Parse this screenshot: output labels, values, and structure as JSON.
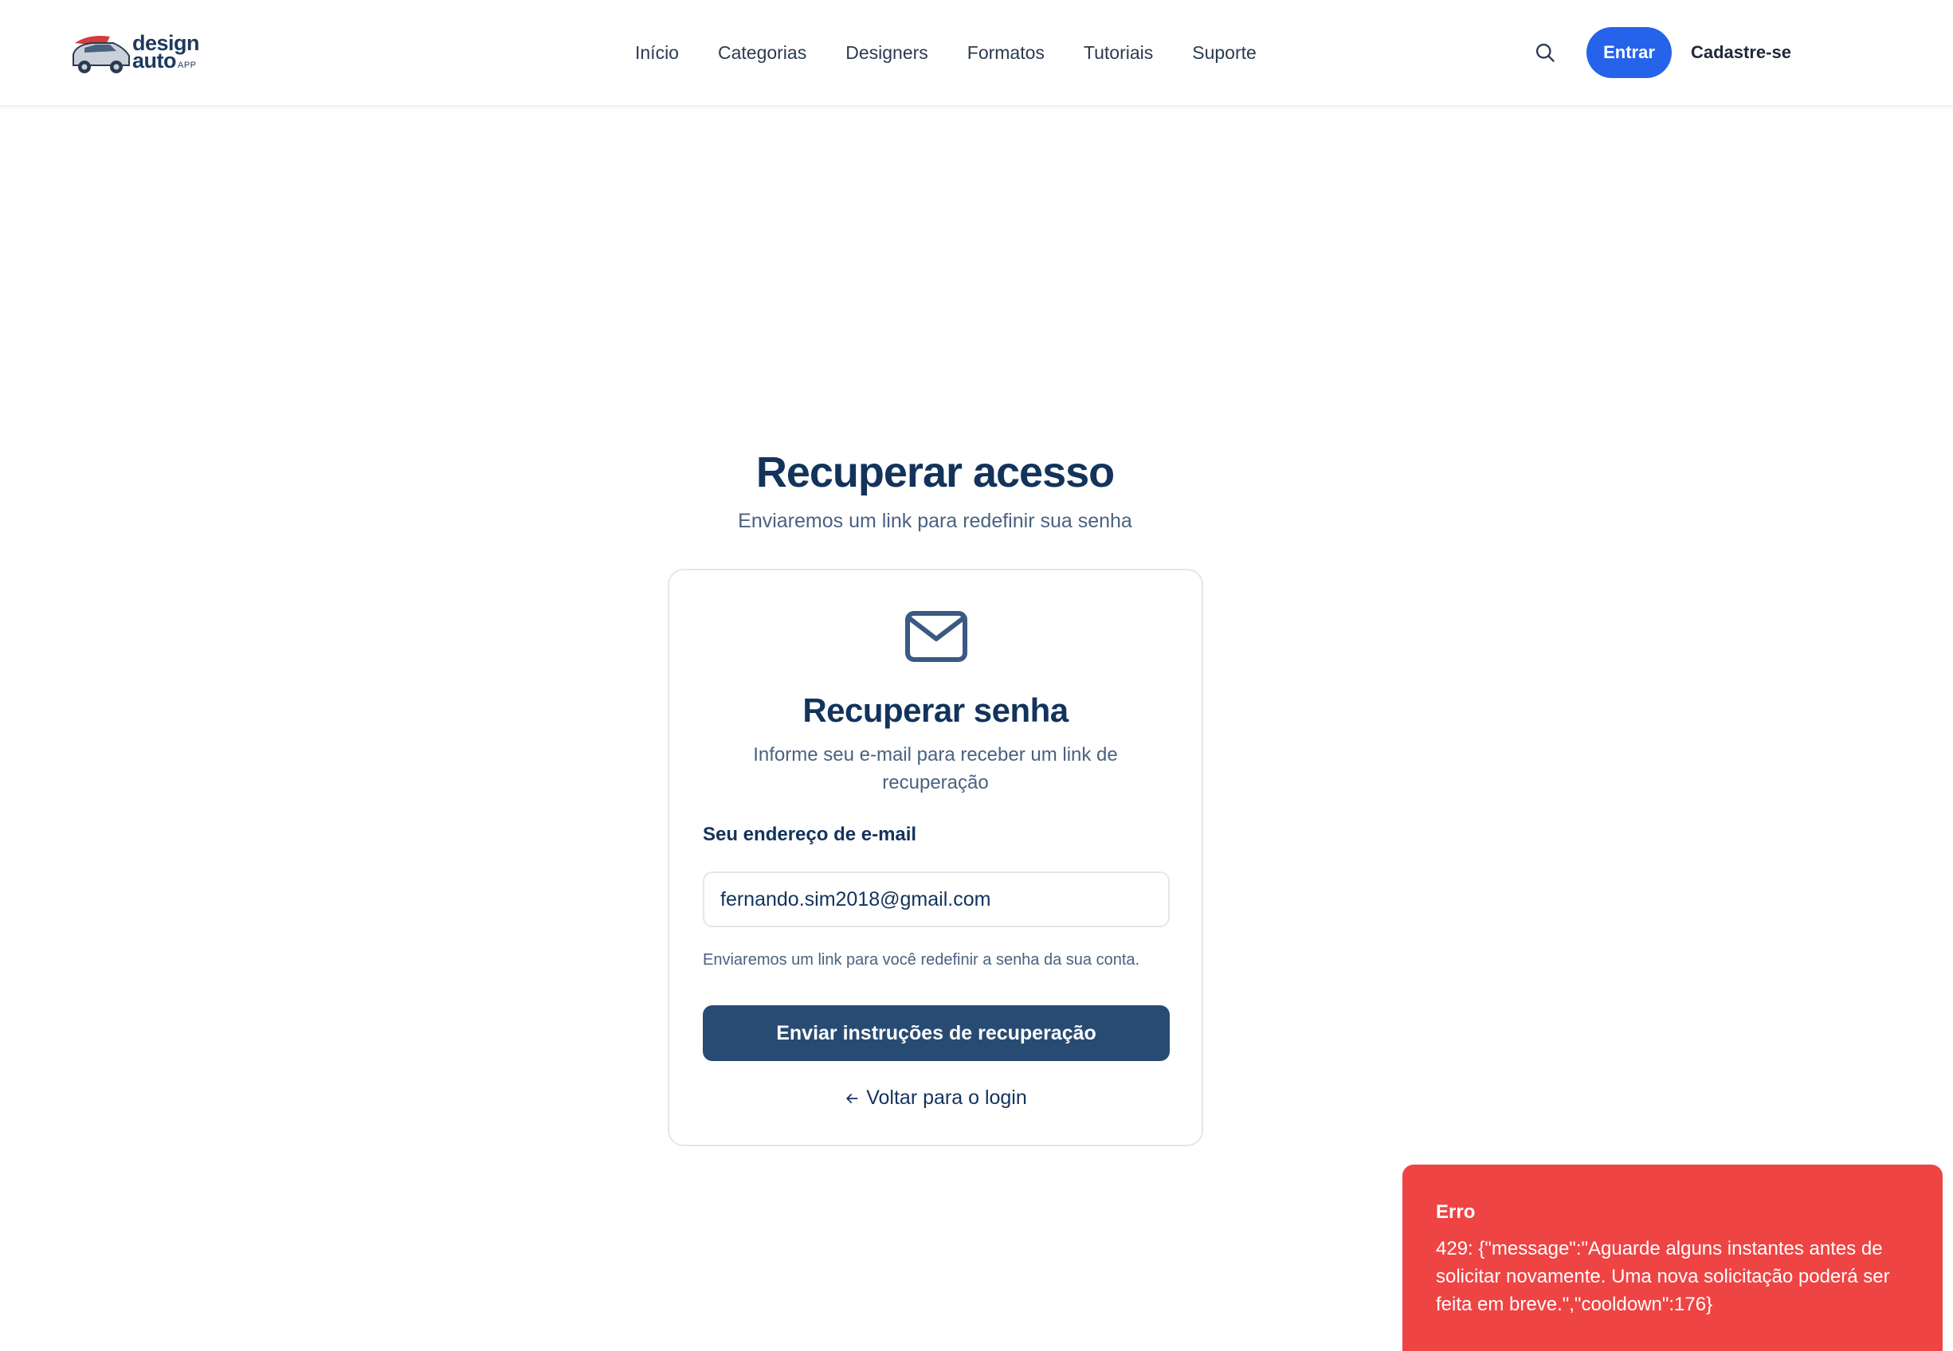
{
  "header": {
    "logo": {
      "line1": "design",
      "line2": "auto",
      "suffix": "APP"
    },
    "nav": [
      {
        "label": "Início"
      },
      {
        "label": "Categorias"
      },
      {
        "label": "Designers"
      },
      {
        "label": "Formatos"
      },
      {
        "label": "Tutoriais"
      },
      {
        "label": "Suporte"
      }
    ],
    "search_icon": "search-icon",
    "login_label": "Entrar",
    "signup_label": "Cadastre-se"
  },
  "main": {
    "title": "Recuperar acesso",
    "subtitle": "Enviaremos um link para redefinir sua senha"
  },
  "card": {
    "icon": "mail-icon",
    "title": "Recuperar senha",
    "description": "Informe seu e-mail para receber um link de recuperação",
    "email_label": "Seu endereço de e-mail",
    "email_value": "fernando.sim2018@gmail.com",
    "helper": "Enviaremos um link para você redefinir a senha da sua conta.",
    "submit_label": "Enviar instruções de recuperação",
    "back_label": "Voltar para o login"
  },
  "toast": {
    "title": "Erro",
    "message": "429: {\"message\":\"Aguarde alguns instantes antes de solicitar novamente. Uma nova solicitação poderá ser feita em breve.\",\"cooldown\":176}"
  },
  "colors": {
    "primary": "#2563eb",
    "navy": "#12335c",
    "button": "#284b73",
    "error": "#ef4444"
  }
}
